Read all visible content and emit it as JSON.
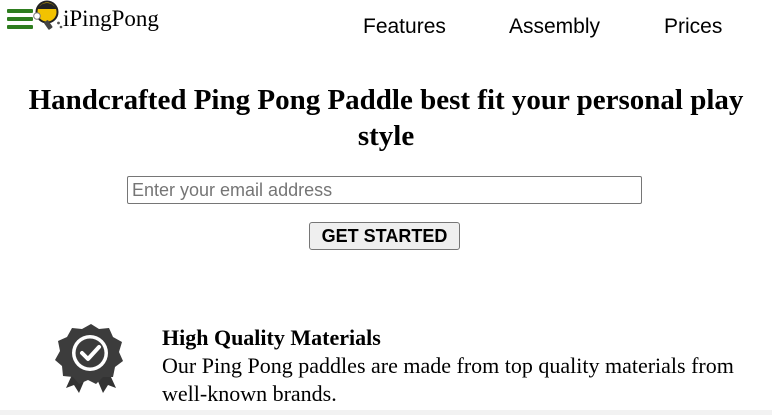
{
  "brand": {
    "name": "iPingPong",
    "logo_icon": "ping-pong-paddle-icon",
    "menu_icon": "hamburger-menu-icon",
    "accent_color": "#2e7d1f"
  },
  "nav": {
    "items": [
      {
        "label": "Features"
      },
      {
        "label": "Assembly"
      },
      {
        "label": "Prices"
      }
    ]
  },
  "hero": {
    "title": "Handcrafted Ping Pong Paddle best fit your personal play style",
    "email_placeholder": "Enter your email address",
    "email_value": "",
    "cta_label": "GET STARTED"
  },
  "features": [
    {
      "icon": "award-badge-icon",
      "title": "High Quality Materials",
      "description": "Our Ping Pong paddles are made from top quality materials from well-known brands."
    }
  ]
}
